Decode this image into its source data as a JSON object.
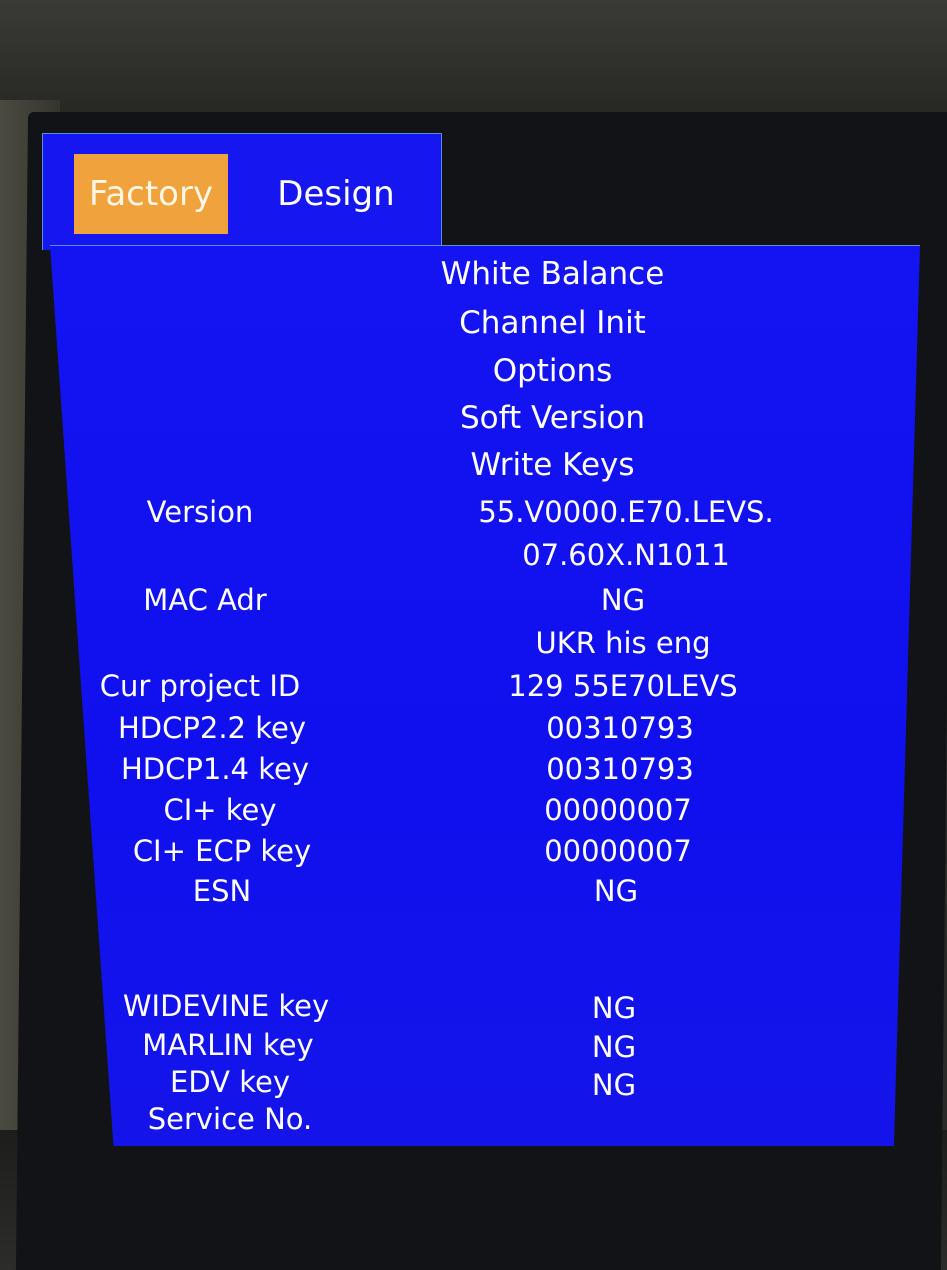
{
  "tabs": {
    "factory": "Factory",
    "design": "Design"
  },
  "menu": {
    "white_balance": "White Balance",
    "channel_init": "Channel Init",
    "options": "Options",
    "soft_version": "Soft Version",
    "write_keys": "Write Keys"
  },
  "info": {
    "version_label": "Version",
    "version_value_1": "55.V0000.E70.LEVS.",
    "version_value_2": "07.60X.N1011",
    "mac_label": "MAC Adr",
    "mac_value": "NG",
    "region_value": "UKR his eng",
    "project_label": "Cur project ID",
    "project_value": "129 55E70LEVS",
    "hdcp22_label": "HDCP2.2 key",
    "hdcp22_value": "00310793",
    "hdcp14_label": "HDCP1.4 key",
    "hdcp14_value": "00310793",
    "ci_label": "CI+ key",
    "ci_value": "00000007",
    "ci_ecp_label": "CI+ ECP key",
    "ci_ecp_value": "00000007",
    "esn_label": "ESN",
    "esn_value": "NG",
    "widevine_label": "WIDEVINE key",
    "widevine_value": "NG",
    "marlin_label": "MARLIN key",
    "marlin_value": "NG",
    "edv_label": "EDV key",
    "edv_value": "NG",
    "service_label": "Service No."
  },
  "colors": {
    "panel_blue": "#1414f2",
    "tab_active": "#f0a23c",
    "text": "#ffffff"
  }
}
